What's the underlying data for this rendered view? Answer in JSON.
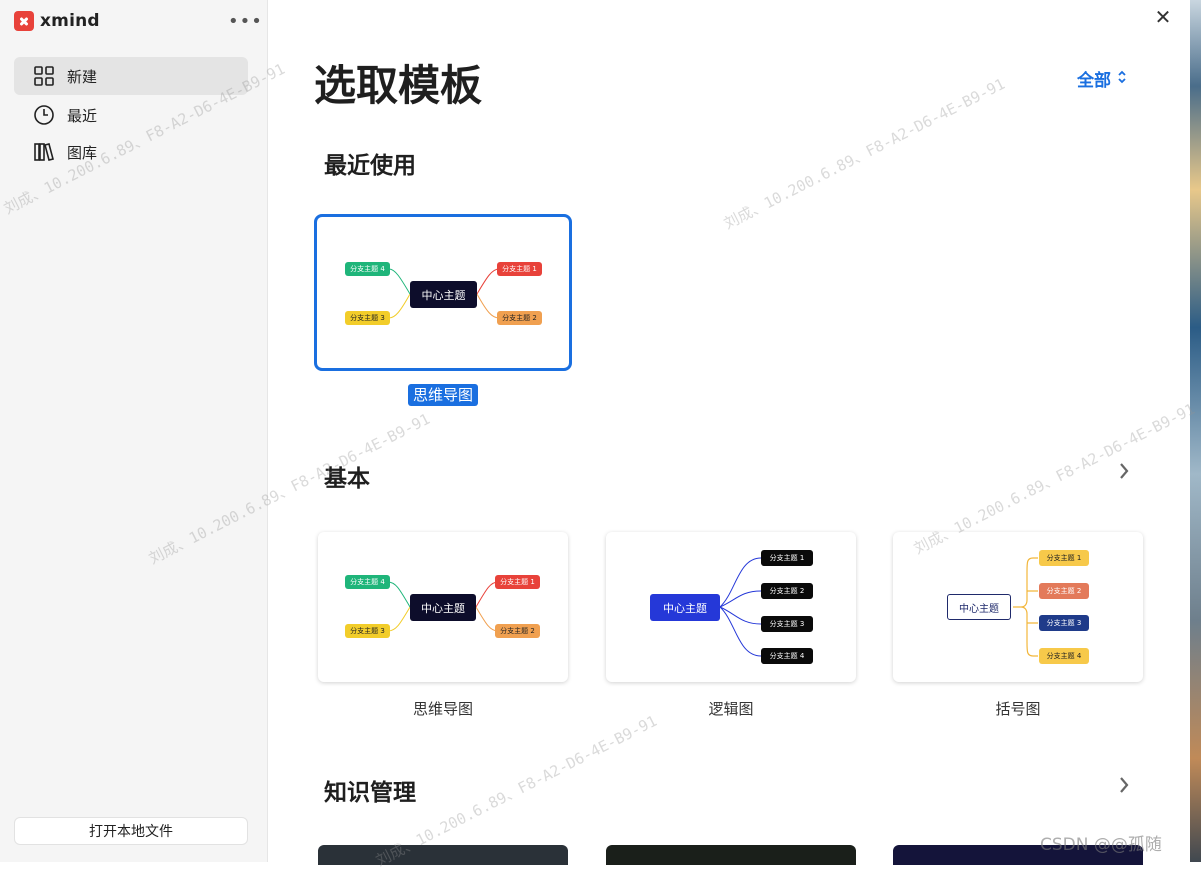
{
  "app": {
    "name": "xmind",
    "more_label": "•••"
  },
  "sidebar": {
    "items": [
      {
        "label": "新建",
        "icon": "grid-icon",
        "active": true
      },
      {
        "label": "最近",
        "icon": "clock-icon",
        "active": false
      },
      {
        "label": "图库",
        "icon": "library-icon",
        "active": false
      }
    ],
    "open_local_label": "打开本地文件"
  },
  "main": {
    "title": "选取模板",
    "filter_label": "全部",
    "close_label": "✕",
    "sections": {
      "recent": {
        "title": "最近使用",
        "cards": [
          {
            "label": "思维导图"
          }
        ]
      },
      "basic": {
        "title": "基本",
        "cards": [
          {
            "label": "思维导图"
          },
          {
            "label": "逻辑图"
          },
          {
            "label": "括号图"
          }
        ]
      },
      "knowledge": {
        "title": "知识管理"
      }
    }
  },
  "mindmap": {
    "center": "中心主题",
    "branches": [
      "分支主题 1",
      "分支主题 2",
      "分支主题 3",
      "分支主题 4"
    ],
    "colors": {
      "b1": "#e8423a",
      "b2": "#f0a050",
      "b3": "#f2cd2a",
      "b4": "#1fb57a",
      "center": "#0d0d2b"
    }
  },
  "logic": {
    "center": "中心主题",
    "branches": [
      "分支主题 1",
      "分支主题 2",
      "分支主题 3",
      "分支主题 4"
    ],
    "colors": {
      "center": "#2538d8",
      "branch": "#0a0a0a"
    }
  },
  "brace": {
    "center": "中心主题",
    "branches": [
      "分支主题 1",
      "分支主题 2",
      "分支主题 3",
      "分支主题 4"
    ],
    "colors": {
      "b1": "#f7c94a",
      "b2": "#e37a5a",
      "b3": "#1f3b8a",
      "b4": "#f7c94a"
    }
  },
  "watermark_text": "刘成、10.200.6.89、F8-A2-D6-4E-B9-91",
  "credit": "CSDN @@孤随"
}
